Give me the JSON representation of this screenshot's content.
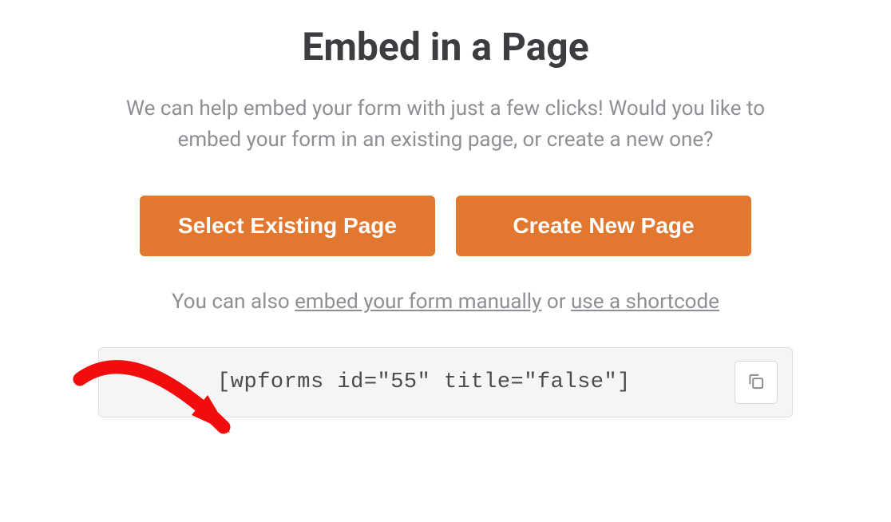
{
  "title": "Embed in a Page",
  "description": "We can help embed your form with just a few clicks! Would you like to embed your form in an existing page, or create a new one?",
  "buttons": {
    "select_existing": "Select Existing Page",
    "create_new": "Create New Page"
  },
  "helper": {
    "prefix": "You can also ",
    "link_manual": "embed your form manually",
    "middle": " or ",
    "link_shortcode": "use a shortcode"
  },
  "shortcode": "[wpforms id=\"55\" title=\"false\"]",
  "colors": {
    "accent": "#e27730"
  }
}
